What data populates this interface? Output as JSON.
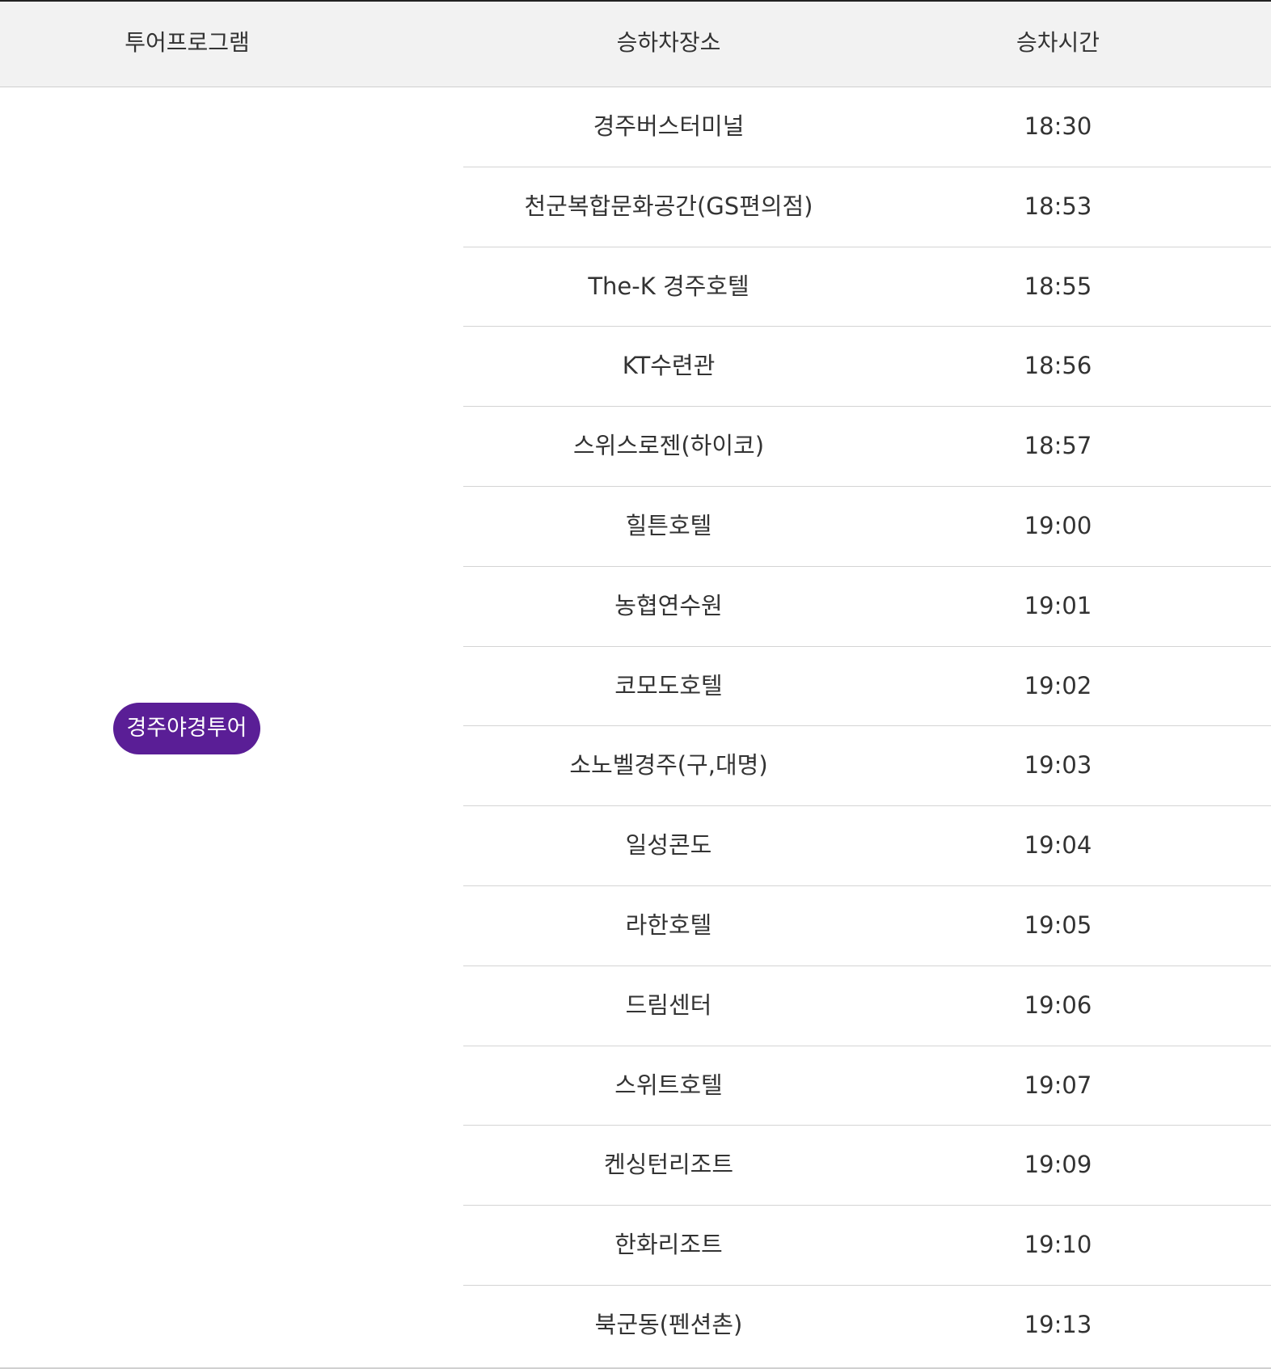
{
  "table": {
    "headers": {
      "program": "투어프로그램",
      "place": "승하차장소",
      "time": "승차시간"
    },
    "program_name": "경주야경투어",
    "program_badge_color": "#5a1e96",
    "rows": [
      {
        "place": "경주버스터미널",
        "time": "18:30"
      },
      {
        "place": "천군복합문화공간(GS편의점)",
        "time": "18:53"
      },
      {
        "place": "The-K 경주호텔",
        "time": "18:55"
      },
      {
        "place": "KT수련관",
        "time": "18:56"
      },
      {
        "place": "스위스로젠(하이코)",
        "time": "18:57"
      },
      {
        "place": "힐튼호텔",
        "time": "19:00"
      },
      {
        "place": "농협연수원",
        "time": "19:01"
      },
      {
        "place": "코모도호텔",
        "time": "19:02"
      },
      {
        "place": "소노벨경주(구,대명)",
        "time": "19:03"
      },
      {
        "place": "일성콘도",
        "time": "19:04"
      },
      {
        "place": "라한호텔",
        "time": "19:05"
      },
      {
        "place": "드림센터",
        "time": "19:06"
      },
      {
        "place": "스위트호텔",
        "time": "19:07"
      },
      {
        "place": "켄싱턴리조트",
        "time": "19:09"
      },
      {
        "place": "한화리조트",
        "time": "19:10"
      },
      {
        "place": "북군동(펜션촌)",
        "time": "19:13"
      }
    ]
  }
}
